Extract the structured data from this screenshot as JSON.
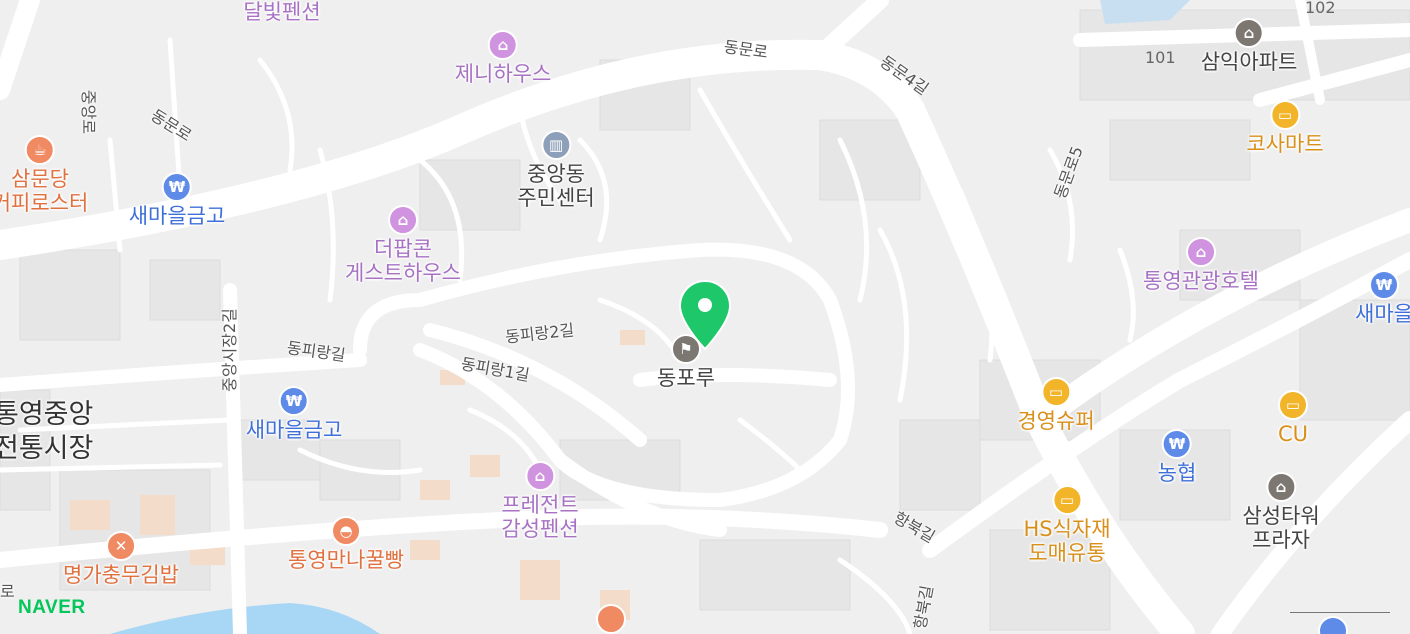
{
  "colors": {
    "lodging": "#cf93df",
    "bank": "#5f8be8",
    "public": "#8e9fb9",
    "food": "#f08a62",
    "store": "#f2b429",
    "landmark": "#7d7772",
    "pin": "#1ec86a",
    "water": "#a8d6f5"
  },
  "pois": [
    {
      "name": "달빛펜션",
      "cat": "lodging",
      "icon": "bed-icon"
    },
    {
      "name": "제니하우스",
      "cat": "lodging",
      "icon": "bed-icon"
    },
    {
      "name": "중앙동\n주민센터",
      "cat": "public",
      "icon": "government-building-icon"
    },
    {
      "name": "삼문당\n커피로스터",
      "cat": "food",
      "icon": "coffee-cup-icon"
    },
    {
      "name": "새마을금고",
      "cat": "bank",
      "icon": "bank-won-icon"
    },
    {
      "name": "더팝콘\n게스트하우스",
      "cat": "lodging",
      "icon": "bed-icon"
    },
    {
      "name": "동포루",
      "cat": "landmark",
      "icon": "flag-icon"
    },
    {
      "name": "새마을금고",
      "cat": "bank",
      "icon": "bank-won-icon"
    },
    {
      "name": "프레전트\n감성펜션",
      "cat": "lodging",
      "icon": "bed-icon"
    },
    {
      "name": "통영만나꿀빵",
      "cat": "food",
      "icon": "bread-icon"
    },
    {
      "name": "명가충무김밥",
      "cat": "food",
      "icon": "fork-knife-icon"
    },
    {
      "name": "삼익아파트",
      "cat": "landmark",
      "icon": "apartment-icon"
    },
    {
      "name": "코사마트",
      "cat": "store",
      "icon": "shopping-basket-icon"
    },
    {
      "name": "통영관광호텔",
      "cat": "lodging",
      "icon": "bed-icon"
    },
    {
      "name": "새마을",
      "cat": "bank",
      "icon": "bank-won-icon"
    },
    {
      "name": "경영슈퍼",
      "cat": "store",
      "icon": "shopping-basket-icon"
    },
    {
      "name": "농협",
      "cat": "bank",
      "icon": "bank-won-icon"
    },
    {
      "name": "CU",
      "cat": "store",
      "icon": "shopping-basket-icon"
    },
    {
      "name": "HS식자재\n도매유통",
      "cat": "store",
      "icon": "shopping-basket-icon"
    },
    {
      "name": "삼성타워\n프라자",
      "cat": "landmark",
      "icon": "apartment-icon"
    }
  ],
  "roads": [
    "동문로",
    "동문로",
    "동문4길",
    "중앙로",
    "동문로5",
    "동피랑2길",
    "동피랑길",
    "동피랑1길",
    "중앙시장2길",
    "항북길",
    "항북길",
    "로"
  ],
  "areas": [
    "통영중앙\n전통시장"
  ],
  "buildings": [
    "101",
    "102"
  ],
  "brand": "NAVER"
}
